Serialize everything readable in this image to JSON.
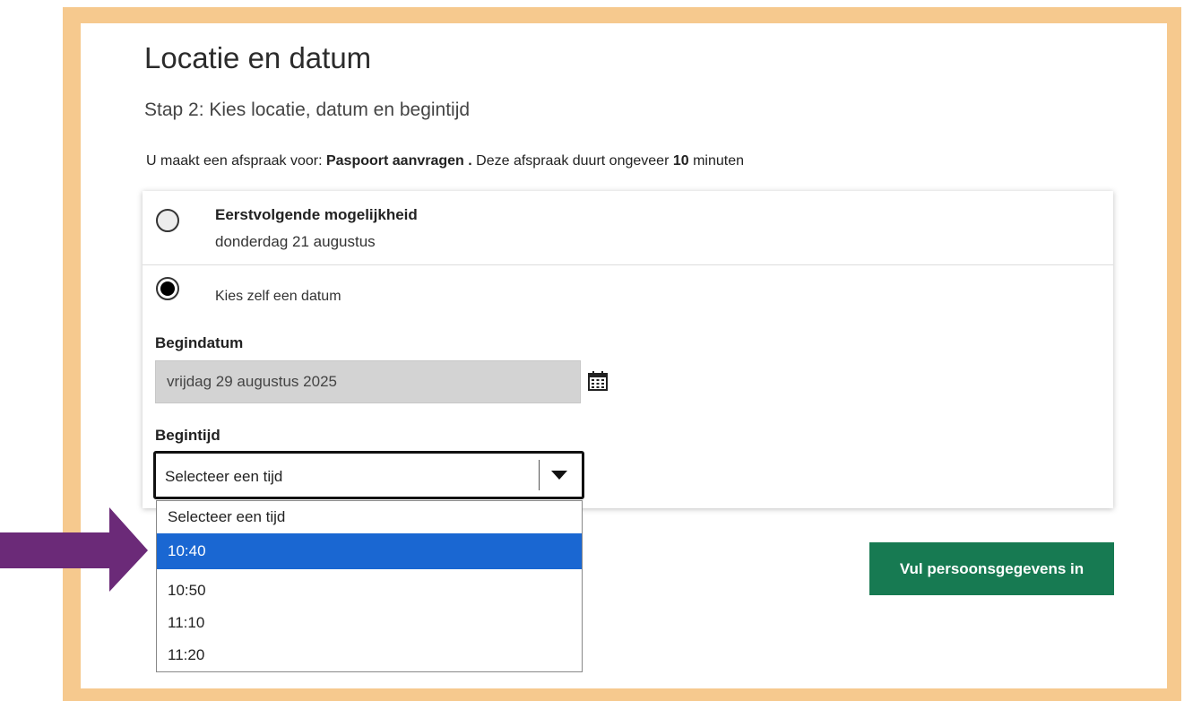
{
  "page": {
    "title": "Locatie en datum",
    "step": "Stap 2: Kies locatie, datum en begintijd",
    "info": {
      "prefix": "U maakt een afspraak voor: ",
      "product": "Paspoort aanvragen .",
      "middle": " Deze afspraak duurt ongeveer ",
      "duration": "10",
      "suffix": " minuten"
    }
  },
  "options": {
    "first_available": {
      "title": "Eerstvolgende mogelijkheid",
      "date": "donderdag 21 augustus",
      "selected": false
    },
    "choose_date": {
      "label": "Kies zelf een datum",
      "selected": true
    }
  },
  "start_date": {
    "label": "Begindatum",
    "value": "vrijdag 29 augustus 2025",
    "icon": "calendar-icon"
  },
  "start_time": {
    "label": "Begintijd",
    "value": "Selecteer een tijd",
    "options": [
      "Selecteer een tijd",
      "10:40",
      "10:50",
      "11:10",
      "11:20"
    ],
    "highlighted": "10:40"
  },
  "buttons": {
    "next": "Vul persoonsgegevens in"
  },
  "colors": {
    "frame": "#f6c98e",
    "highlight": "#1a67d2",
    "button": "#177a52",
    "arrow": "#6b2a78"
  }
}
